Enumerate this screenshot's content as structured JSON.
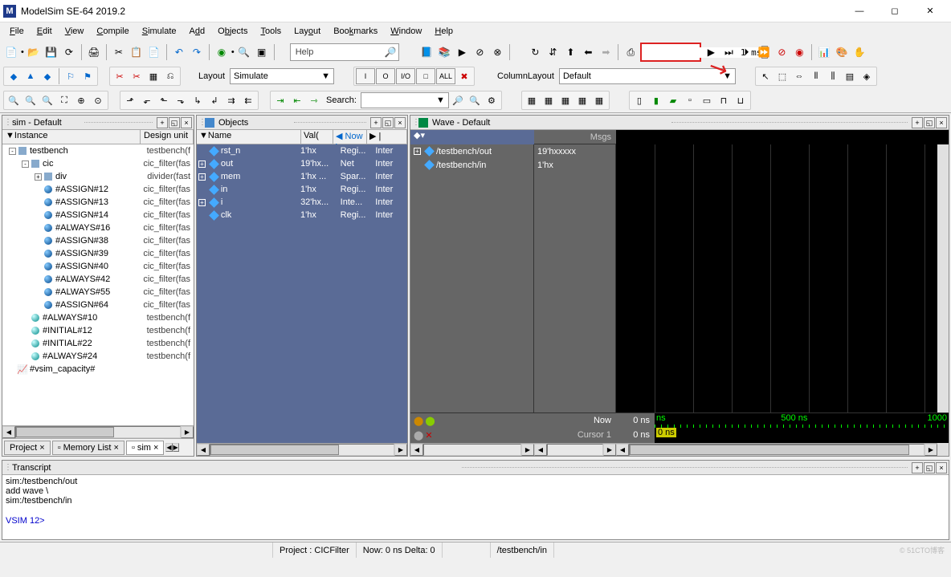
{
  "title": "ModelSim SE-64 2019.2",
  "menus": [
    "File",
    "Edit",
    "View",
    "Compile",
    "Simulate",
    "Add",
    "Objects",
    "Tools",
    "Layout",
    "Bookmarks",
    "Window",
    "Help"
  ],
  "help_label": "Help",
  "layout_label": "Layout",
  "layout_value": "Simulate",
  "columnlayout_label": "ColumnLayout",
  "columnlayout_value": "Default",
  "search_label": "Search:",
  "time_value": "1 ms",
  "sim_panel": {
    "title": "sim - Default",
    "cols": [
      "Instance",
      "Design unit"
    ],
    "tree": [
      {
        "depth": 0,
        "toggle": "-",
        "icon": "box",
        "label": "testbench",
        "unit": "testbench(f"
      },
      {
        "depth": 1,
        "toggle": "-",
        "icon": "box",
        "label": "cic",
        "unit": "cic_filter(fas"
      },
      {
        "depth": 2,
        "toggle": "+",
        "icon": "box",
        "label": "div",
        "unit": "divider(fast"
      },
      {
        "depth": 2,
        "toggle": "",
        "icon": "ball",
        "label": "#ASSIGN#12",
        "unit": "cic_filter(fas"
      },
      {
        "depth": 2,
        "toggle": "",
        "icon": "ball",
        "label": "#ASSIGN#13",
        "unit": "cic_filter(fas"
      },
      {
        "depth": 2,
        "toggle": "",
        "icon": "ball",
        "label": "#ASSIGN#14",
        "unit": "cic_filter(fas"
      },
      {
        "depth": 2,
        "toggle": "",
        "icon": "ball",
        "label": "#ALWAYS#16",
        "unit": "cic_filter(fas"
      },
      {
        "depth": 2,
        "toggle": "",
        "icon": "ball",
        "label": "#ASSIGN#38",
        "unit": "cic_filter(fas"
      },
      {
        "depth": 2,
        "toggle": "",
        "icon": "ball",
        "label": "#ASSIGN#39",
        "unit": "cic_filter(fas"
      },
      {
        "depth": 2,
        "toggle": "",
        "icon": "ball",
        "label": "#ASSIGN#40",
        "unit": "cic_filter(fas"
      },
      {
        "depth": 2,
        "toggle": "",
        "icon": "ball",
        "label": "#ALWAYS#42",
        "unit": "cic_filter(fas"
      },
      {
        "depth": 2,
        "toggle": "",
        "icon": "ball",
        "label": "#ALWAYS#55",
        "unit": "cic_filter(fas"
      },
      {
        "depth": 2,
        "toggle": "",
        "icon": "ball",
        "label": "#ASSIGN#64",
        "unit": "cic_filter(fas"
      },
      {
        "depth": 1,
        "toggle": "",
        "icon": "ball-cyan",
        "label": "#ALWAYS#10",
        "unit": "testbench(f"
      },
      {
        "depth": 1,
        "toggle": "",
        "icon": "ball-cyan",
        "label": "#INITIAL#12",
        "unit": "testbench(f"
      },
      {
        "depth": 1,
        "toggle": "",
        "icon": "ball-cyan",
        "label": "#INITIAL#22",
        "unit": "testbench(f"
      },
      {
        "depth": 1,
        "toggle": "",
        "icon": "ball-cyan",
        "label": "#ALWAYS#24",
        "unit": "testbench(f"
      },
      {
        "depth": 0,
        "toggle": "",
        "icon": "chart",
        "label": "#vsim_capacity#",
        "unit": ""
      }
    ]
  },
  "objects_panel": {
    "title": "Objects",
    "cols": [
      "Name",
      "Val(",
      "Now",
      "",
      ""
    ],
    "rows": [
      {
        "toggle": "",
        "name": "rst_n",
        "val": "1'hx",
        "kind": "Regi...",
        "mode": "Inter"
      },
      {
        "toggle": "+",
        "name": "out",
        "val": "19'hx...",
        "kind": "Net",
        "mode": "Inter"
      },
      {
        "toggle": "+",
        "name": "mem",
        "val": "1'hx ...",
        "kind": "Spar...",
        "mode": "Inter"
      },
      {
        "toggle": "",
        "name": "in",
        "val": "1'hx",
        "kind": "Regi...",
        "mode": "Inter"
      },
      {
        "toggle": "+",
        "name": "i",
        "val": "32'hx...",
        "kind": "Inte...",
        "mode": "Inter"
      },
      {
        "toggle": "",
        "name": "clk",
        "val": "1'hx",
        "kind": "Regi...",
        "mode": "Inter"
      }
    ]
  },
  "wave_panel": {
    "title": "Wave - Default",
    "msgs_label": "Msgs",
    "signals": [
      {
        "toggle": "+",
        "name": "/testbench/out",
        "val": "19'hxxxxx"
      },
      {
        "toggle": "",
        "name": "/testbench/in",
        "val": "1'hx"
      }
    ],
    "now_label": "Now",
    "now_val": "0 ns",
    "cursor_label": "Cursor 1",
    "cursor_val": "0 ns",
    "ruler_start": "ns",
    "ruler_box": "0 ns",
    "ruler_mid": "500 ns",
    "ruler_end": "1000"
  },
  "tabs": [
    {
      "label": "Project",
      "active": false,
      "icon": ""
    },
    {
      "label": "Memory List",
      "active": false,
      "icon": "mem"
    },
    {
      "label": "sim",
      "active": true,
      "icon": "sim"
    }
  ],
  "transcript": {
    "title": "Transcript",
    "lines": [
      "sim:/testbench/out",
      "add wave  \\",
      "sim:/testbench/in"
    ],
    "prompt": "VSIM 12>"
  },
  "statusbar": {
    "project": "Project : CICFilter",
    "now": "Now: 0 ns  Delta: 0",
    "signal": "/testbench/in"
  },
  "io_btns": [
    "I",
    "O",
    "I/O",
    "□",
    "ALL"
  ],
  "watermark": "© 51CTO博客"
}
